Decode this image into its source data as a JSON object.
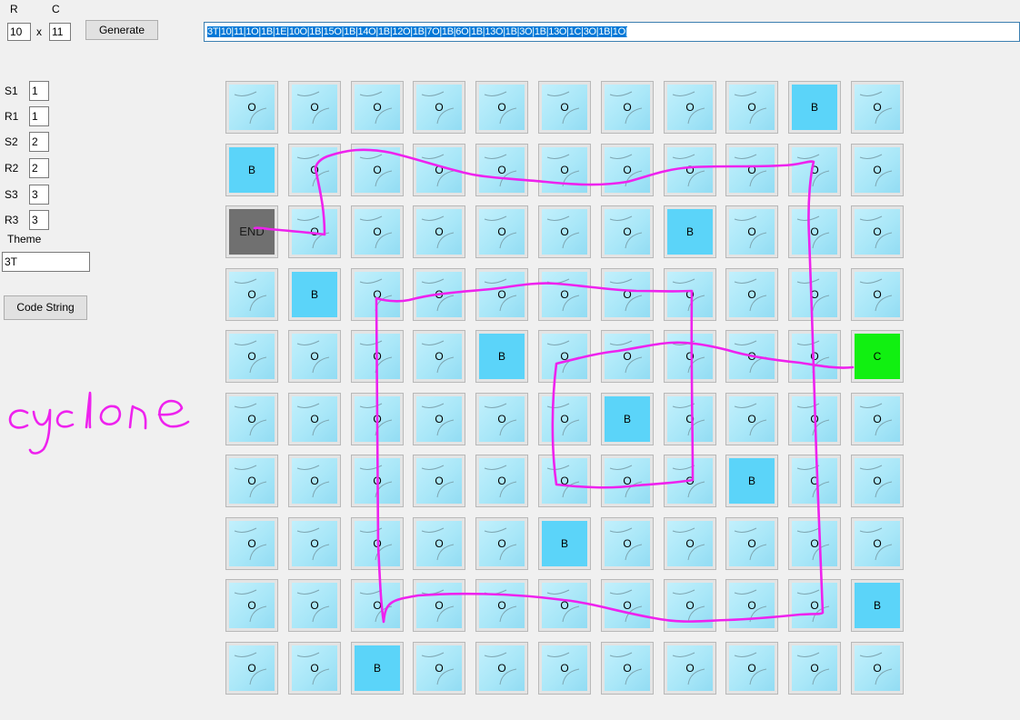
{
  "controls": {
    "r_label": "R",
    "c_label": "C",
    "rows_value": "10",
    "times_label": "x",
    "cols_value": "11",
    "generate_label": "Generate",
    "code_string_value": "3T|10|11|1O|1B|1E|10O|1B|15O|1B|14O|1B|12O|1B|7O|1B|6O|1B|13O|1B|3O|1B|13O|1C|3O|1B|1O|"
  },
  "sidebar": {
    "fields": [
      {
        "label": "S1",
        "value": "1"
      },
      {
        "label": "R1",
        "value": "1"
      },
      {
        "label": "S2",
        "value": "2"
      },
      {
        "label": "R2",
        "value": "2"
      },
      {
        "label": "S3",
        "value": "3"
      },
      {
        "label": "R3",
        "value": "3"
      }
    ],
    "theme_label": "Theme",
    "theme_value": "3T",
    "code_string_button": "Code String"
  },
  "annotation": {
    "handwritten_text": "cyclone",
    "pen_color": "#ee22ee"
  },
  "board": {
    "rows": [
      [
        "O",
        "O",
        "O",
        "O",
        "O",
        "O",
        "O",
        "O",
        "O",
        "B",
        "O"
      ],
      [
        "B",
        "O",
        "O",
        "O",
        "O",
        "O",
        "O",
        "O",
        "O",
        "O",
        "O"
      ],
      [
        "END",
        "O",
        "O",
        "O",
        "O",
        "O",
        "O",
        "B",
        "O",
        "O",
        "O"
      ],
      [
        "O",
        "B",
        "O",
        "O",
        "O",
        "O",
        "O",
        "O",
        "O",
        "O",
        "O"
      ],
      [
        "O",
        "O",
        "O",
        "O",
        "B",
        "O",
        "O",
        "O",
        "O",
        "O",
        "C"
      ],
      [
        "O",
        "O",
        "O",
        "O",
        "O",
        "O",
        "B",
        "O",
        "O",
        "O",
        "O"
      ],
      [
        "O",
        "O",
        "O",
        "O",
        "O",
        "O",
        "O",
        "O",
        "B",
        "O",
        "O"
      ],
      [
        "O",
        "O",
        "O",
        "O",
        "O",
        "B",
        "O",
        "O",
        "O",
        "O",
        "O"
      ],
      [
        "O",
        "O",
        "O",
        "O",
        "O",
        "O",
        "O",
        "O",
        "O",
        "O",
        "B"
      ],
      [
        "O",
        "O",
        "B",
        "O",
        "O",
        "O",
        "O",
        "O",
        "O",
        "O",
        "O"
      ]
    ],
    "colors": {
      "open": "#a9e7f8",
      "blocked": "#5bd4f9",
      "current": "#11f011",
      "end": "#707070"
    }
  }
}
